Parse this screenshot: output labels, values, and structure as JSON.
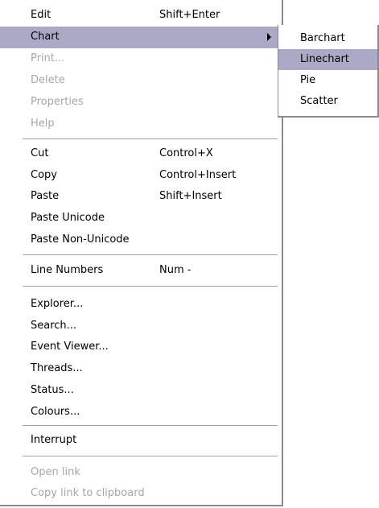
{
  "menu": {
    "items": [
      {
        "label": "Edit",
        "shortcut": "Shift+Enter"
      },
      {
        "label": "Chart",
        "shortcut": ""
      },
      {
        "label": "Print...",
        "shortcut": ""
      },
      {
        "label": "Delete",
        "shortcut": ""
      },
      {
        "label": "Properties",
        "shortcut": ""
      },
      {
        "label": "Help",
        "shortcut": ""
      },
      {
        "label": "Cut",
        "shortcut": "Control+X"
      },
      {
        "label": "Copy",
        "shortcut": "Control+Insert"
      },
      {
        "label": "Paste",
        "shortcut": "Shift+Insert"
      },
      {
        "label": "Paste Unicode",
        "shortcut": ""
      },
      {
        "label": "Paste Non-Unicode",
        "shortcut": ""
      },
      {
        "label": "Line Numbers",
        "shortcut": "Num -"
      },
      {
        "label": "Explorer...",
        "shortcut": ""
      },
      {
        "label": "Search...",
        "shortcut": ""
      },
      {
        "label": "Event Viewer...",
        "shortcut": ""
      },
      {
        "label": "Threads...",
        "shortcut": ""
      },
      {
        "label": "Status...",
        "shortcut": ""
      },
      {
        "label": "Colours...",
        "shortcut": ""
      },
      {
        "label": "Interrupt",
        "shortcut": ""
      },
      {
        "label": "Open link",
        "shortcut": ""
      },
      {
        "label": "Copy link to clipboard",
        "shortcut": ""
      }
    ]
  },
  "submenu": {
    "items": [
      {
        "label": "Barchart"
      },
      {
        "label": "Linechart"
      },
      {
        "label": "Pie"
      },
      {
        "label": "Scatter"
      }
    ]
  },
  "colors": {
    "highlight": "#aaaac6",
    "disabled_text": "#a6a6a6",
    "border": "#8a8a8a",
    "separator": "#a0a0a0"
  }
}
